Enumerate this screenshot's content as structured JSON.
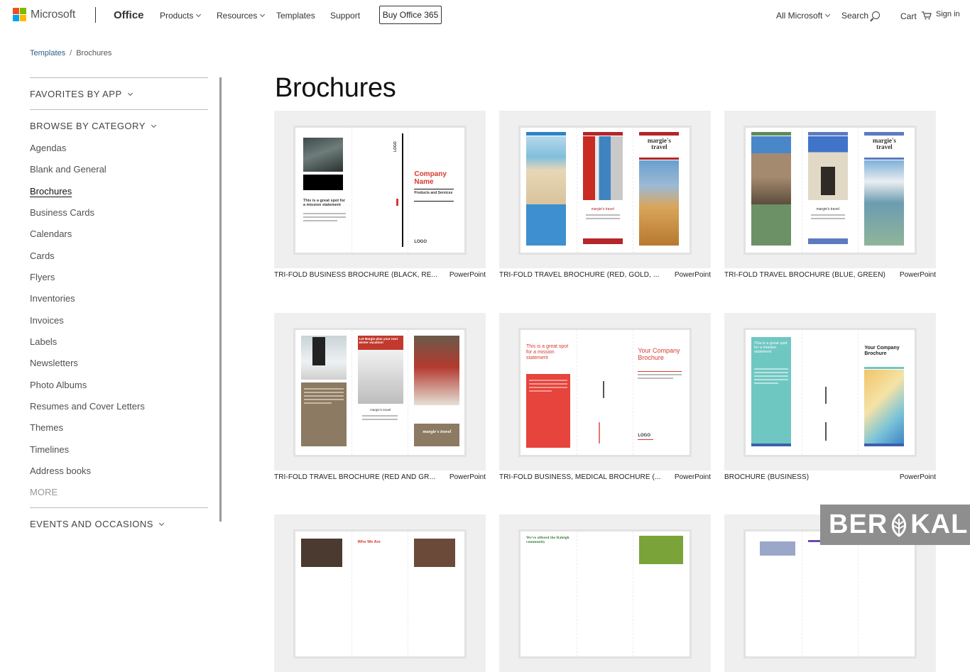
{
  "header": {
    "brand": "Microsoft",
    "product": "Office",
    "nav": [
      {
        "label": "Products",
        "caret": true
      },
      {
        "label": "Resources",
        "caret": true
      },
      {
        "label": "Templates",
        "caret": false
      },
      {
        "label": "Support",
        "caret": false
      }
    ],
    "buy_button": "Buy Office 365",
    "right_nav": {
      "all_microsoft": "All Microsoft",
      "search": "Search",
      "cart": "Cart",
      "signin": "Sign in"
    }
  },
  "breadcrumb": {
    "parent": "Templates",
    "separator": "/",
    "current": "Brochures"
  },
  "sidebar": {
    "favorites_header": "FAVORITES BY APP",
    "browse_header": "BROWSE BY CATEGORY",
    "categories": [
      "Agendas",
      "Blank and General",
      "Brochures",
      "Business Cards",
      "Calendars",
      "Cards",
      "Flyers",
      "Inventories",
      "Invoices",
      "Labels",
      "Newsletters",
      "Photo Albums",
      "Resumes and Cover Letters",
      "Themes",
      "Timelines",
      "Address books"
    ],
    "active_category": "Brochures",
    "more": "MORE",
    "events_header": "EVENTS AND OCCASIONS"
  },
  "page_title": "Brochures",
  "templates": [
    {
      "title": "TRI-FOLD BUSINESS BROCHURE (BLACK, RE...",
      "app": "PowerPoint",
      "thumb_text": {
        "mission": "This is a great spot for a mission statement",
        "company": "Company Name",
        "products": "Products and Services",
        "logo": "LOGO"
      }
    },
    {
      "title": "TRI-FOLD TRAVEL BROCHURE (RED, GOLD, ...",
      "app": "PowerPoint",
      "thumb_text": {
        "brand": "margie's travel"
      }
    },
    {
      "title": "TRI-FOLD TRAVEL BROCHURE (BLUE, GREEN)",
      "app": "PowerPoint",
      "thumb_text": {
        "brand": "margie's travel"
      }
    },
    {
      "title": "TRI-FOLD TRAVEL BROCHURE (RED AND GR...",
      "app": "PowerPoint",
      "thumb_text": {
        "headline": "Let Margie plan your next winter vacation!",
        "brand": "margie's travel"
      }
    },
    {
      "title": "TRI-FOLD BUSINESS, MEDICAL BROCHURE (...",
      "app": "PowerPoint",
      "thumb_text": {
        "mission": "This is a great spot for a mission statement",
        "company": "Your Company Brochure",
        "logo": "LOGO"
      }
    },
    {
      "title": "BROCHURE (BUSINESS)",
      "app": "PowerPoint",
      "thumb_text": {
        "mission": "This is a great spot for a mission statement",
        "company": "Your Company Brochure"
      }
    },
    {
      "title": "",
      "app": "",
      "thumb_text": {
        "headline": "Who We Are"
      }
    },
    {
      "title": "",
      "app": "",
      "thumb_text": {
        "headline": "We've offered the Raleigh community"
      }
    },
    {
      "title": "",
      "app": "",
      "thumb_text": {}
    }
  ],
  "watermark": {
    "text_left": "BER",
    "text_right": "KAL"
  },
  "colors": {
    "ms_red": "#f25022",
    "ms_green": "#7fba00",
    "ms_blue": "#00a4ef",
    "ms_yellow": "#ffb900",
    "link": "#2a5e8c",
    "accent_red": "#d43b2f",
    "thumb_bg": "#efefef"
  }
}
